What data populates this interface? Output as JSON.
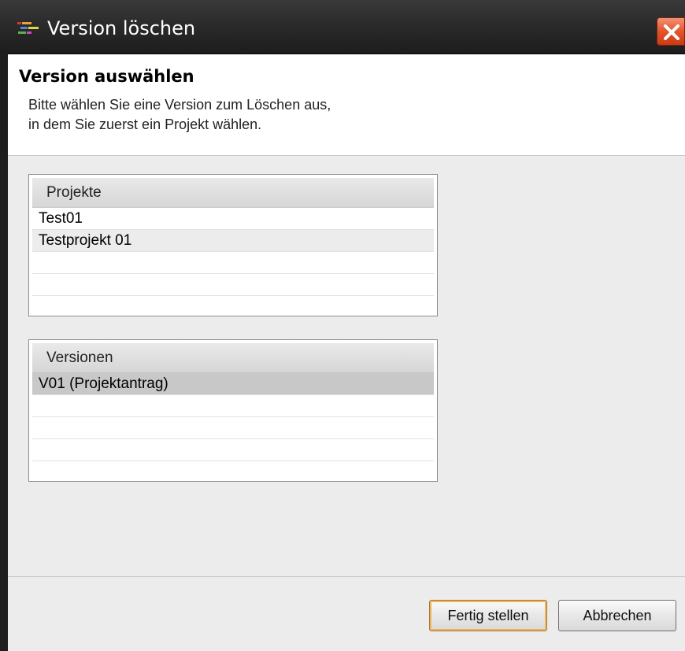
{
  "window": {
    "title": "Version löschen"
  },
  "header": {
    "title": "Version auswählen",
    "description": "Bitte wählen Sie eine Version zum Löschen aus,\nin dem Sie zuerst ein Projekt wählen."
  },
  "projects": {
    "column_header": "Projekte",
    "items": [
      "Test01",
      "Testprojekt 01"
    ]
  },
  "versions": {
    "column_header": "Versionen",
    "items": [
      "V01 (Projektantrag)"
    ]
  },
  "buttons": {
    "finish_label": "Fertig stellen",
    "cancel_label": "Abbrechen"
  },
  "colors": {
    "close_button": "#e2542c",
    "default_button_glow": "#f0b45a",
    "selection": "#c8c8c8"
  }
}
